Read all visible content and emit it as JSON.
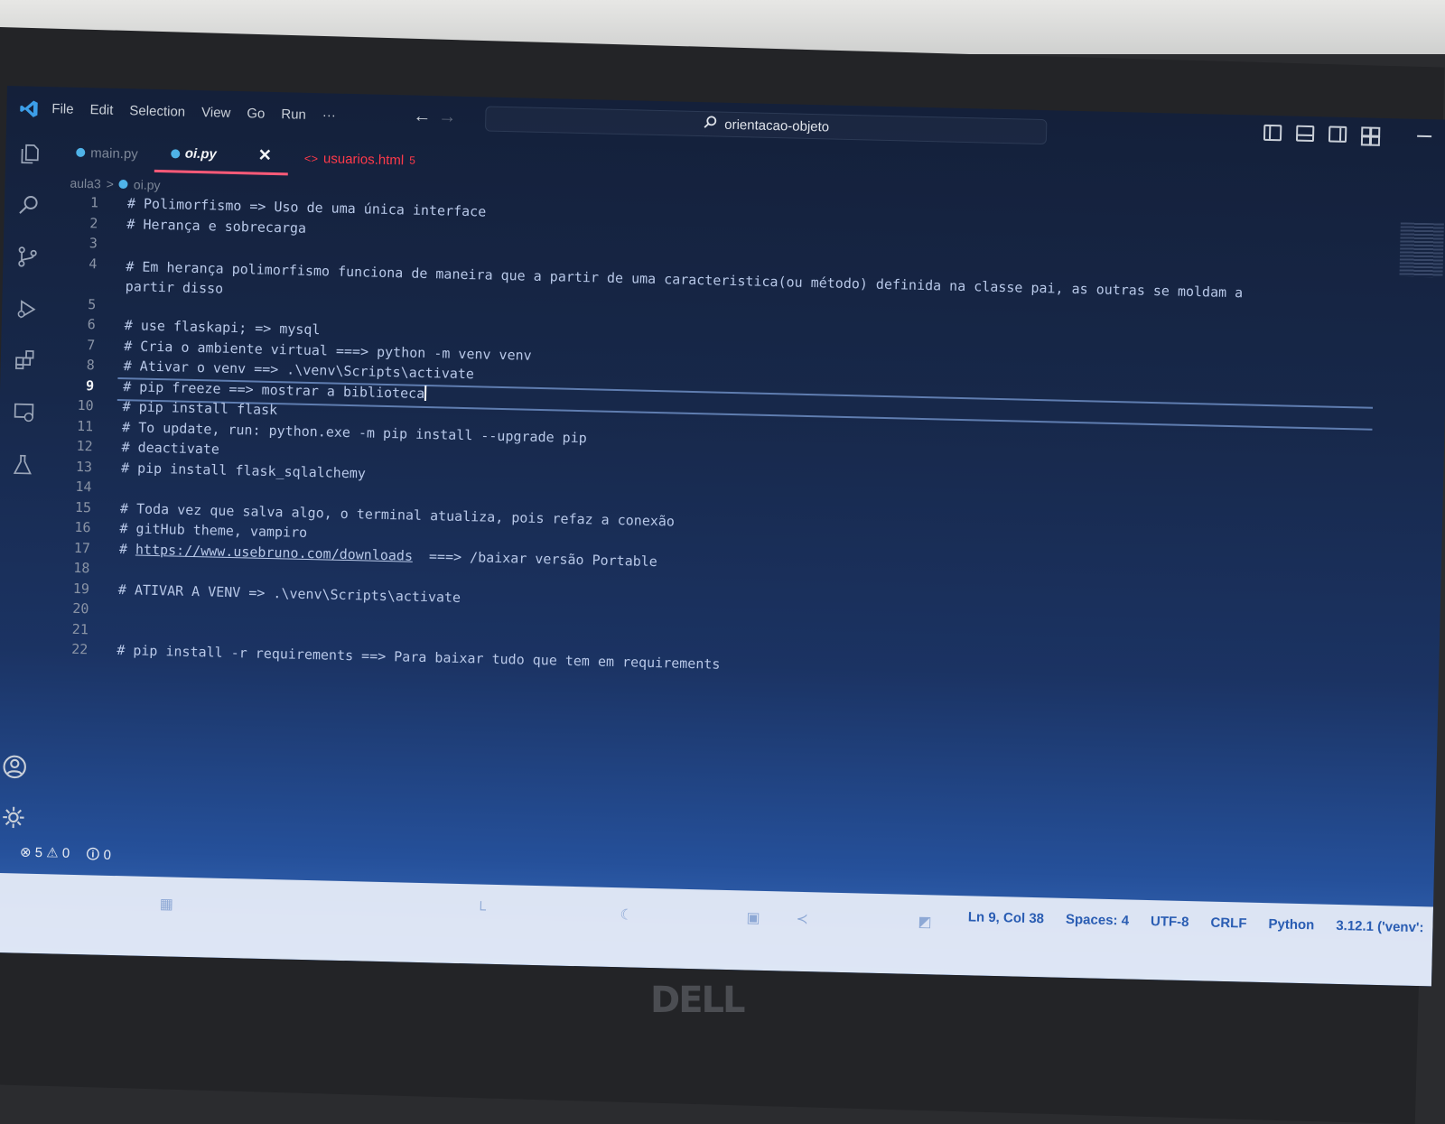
{
  "window": {
    "menu": [
      "File",
      "Edit",
      "Selection",
      "View",
      "Go",
      "Run",
      "···"
    ],
    "search_text": "orientacao-objeto"
  },
  "tabs": [
    {
      "label": "main.py",
      "state": "inactive"
    },
    {
      "label": "oi.py",
      "state": "active",
      "close": "✕"
    },
    {
      "label": "usuarios.html",
      "state": "modified",
      "badge": "5"
    }
  ],
  "breadcrumb": {
    "folder": "aula3",
    "sep": ">",
    "file": "oi.py"
  },
  "editor": {
    "lines": [
      {
        "n": "1",
        "text": "# Polimorfismo => Uso de uma única interface"
      },
      {
        "n": "2",
        "text": "# Herança e sobrecarga"
      },
      {
        "n": "3",
        "text": ""
      },
      {
        "n": "4",
        "text": "# Em herança polimorfismo funciona de maneira que a partir de uma caracteristica(ou método) definida na classe pai, as outras se moldam a",
        "text2": "partir disso"
      },
      {
        "n": "5",
        "text": ""
      },
      {
        "n": "6",
        "text": "# use flaskapi; => mysql"
      },
      {
        "n": "7",
        "text": "# Cria o ambiente virtual ===> python -m venv venv"
      },
      {
        "n": "8",
        "text": "# Ativar o venv ==> .\\venv\\Scripts\\activate"
      },
      {
        "n": "9",
        "text": "# pip freeze ==> mostrar a biblioteca",
        "current": true
      },
      {
        "n": "10",
        "text": "# pip install flask"
      },
      {
        "n": "11",
        "text": "# To update, run: python.exe -m pip install --upgrade pip"
      },
      {
        "n": "12",
        "text": "# deactivate"
      },
      {
        "n": "13",
        "text": "# pip install flask_sqlalchemy"
      },
      {
        "n": "14",
        "text": ""
      },
      {
        "n": "15",
        "text": "# Toda vez que salva algo, o terminal atualiza, pois refaz a conexão"
      },
      {
        "n": "16",
        "text": "# gitHub theme, vampiro"
      },
      {
        "n": "17",
        "text": "# ",
        "link": "https://www.usebruno.com/downloads",
        "after": "  ===> /baixar versão Portable"
      },
      {
        "n": "18",
        "text": ""
      },
      {
        "n": "19",
        "text": "# ATIVAR A VENV => .\\venv\\Scripts\\activate"
      },
      {
        "n": "20",
        "text": ""
      },
      {
        "n": "21",
        "text": ""
      },
      {
        "n": "22",
        "text": "# pip install -r requirements ==> Para baixar tudo que tem em requirements"
      }
    ]
  },
  "status": {
    "errors": "⊗ 5",
    "warnings": "⚠ 0",
    "ports": "🛈 0",
    "position": "Ln 9, Col 38",
    "spaces": "Spaces: 4",
    "encoding": "UTF-8",
    "eol": "CRLF",
    "language": "Python",
    "interpreter": "3.12.1 ('venv':"
  },
  "brand": "DELL",
  "colors": {
    "accent_tab": "#ff5a78",
    "modified": "#ff3a4a",
    "vscode_blue": "#3c9ee8"
  }
}
